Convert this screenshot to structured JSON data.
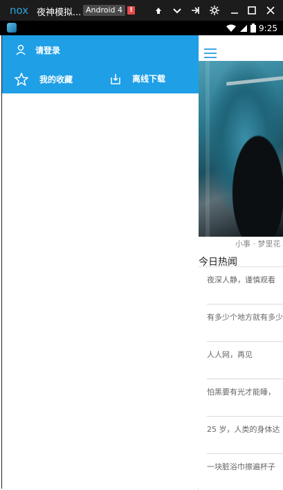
{
  "emulator": {
    "logo_text": "nox",
    "title": "夜神模拟...",
    "badge": "Android 4",
    "alert": "!",
    "controls": [
      "pin-icon",
      "chevron-down-icon",
      "share-icon",
      "gear-icon",
      "minimize-icon",
      "maximize-icon",
      "close-icon"
    ]
  },
  "status_bar": {
    "time": "9:25",
    "icons": [
      "wifi-icon",
      "signal-icon",
      "battery-icon"
    ]
  },
  "drawer": {
    "login_label": "请登录",
    "favorites_label": "我的收藏",
    "offline_label": "离线下载"
  },
  "main": {
    "banner_caption": "小事 · 梦里花",
    "section_title": "今日热闻",
    "news": [
      {
        "title": "夜深人静，谨慎观看"
      },
      {
        "title": "有多少个地方就有多少"
      },
      {
        "title": "人人网，再见"
      },
      {
        "title": "怕黑要有光才能睡，"
      },
      {
        "title": "25 岁，人类的身体达"
      },
      {
        "title": "一块脏浴巾擦遍杯子"
      }
    ]
  },
  "colors": {
    "header_blue": "#1e9fe6",
    "menu_blue": "#3ea5e8",
    "emulator_bg": "#1c1c1c",
    "logo_blue": "#2aa6df"
  }
}
